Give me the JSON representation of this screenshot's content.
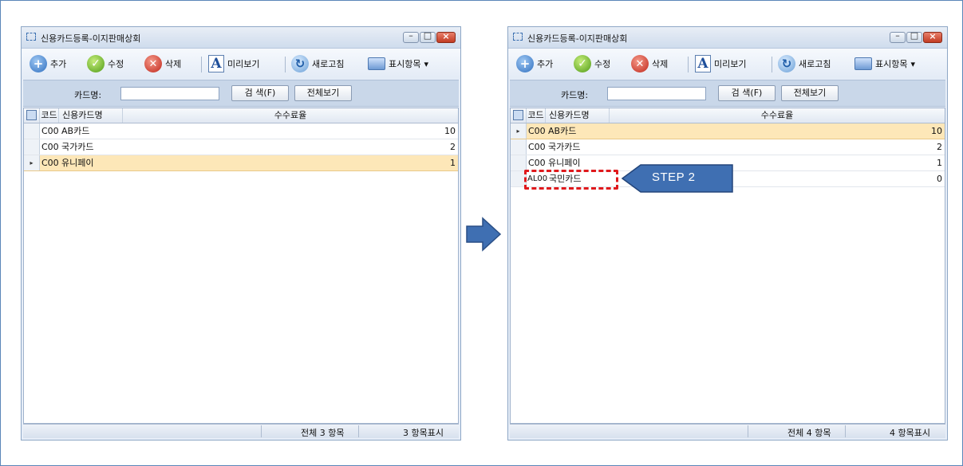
{
  "windows": [
    {
      "id": "left",
      "title": "신용카드등록-이지판매상회",
      "toolbar": {
        "add": "추가",
        "edit": "수정",
        "delete": "삭제",
        "preview": "미리보기",
        "refresh": "새로고침",
        "columns": "표시항목",
        "preview_glyph": "A",
        "dropdown_glyph": "▾"
      },
      "search": {
        "label": "카드명:",
        "value": "",
        "search_button": "검 색(F)",
        "viewall_button": "전체보기"
      },
      "grid": {
        "headers": {
          "code": "코드",
          "name": "신용카드명",
          "rate": "수수료율"
        },
        "rows": [
          {
            "code": "C001",
            "name": "AB카드",
            "rate": "10",
            "selected": false
          },
          {
            "code": "C002",
            "name": "국가카드",
            "rate": "2",
            "selected": false
          },
          {
            "code": "C003",
            "name": "유니페이",
            "rate": "1",
            "selected": true
          }
        ]
      },
      "status": {
        "total": "전체 3 항목",
        "shown": "3 항목표시"
      }
    },
    {
      "id": "right",
      "title": "신용카드등록-이지판매상회",
      "toolbar": {
        "add": "추가",
        "edit": "수정",
        "delete": "삭제",
        "preview": "미리보기",
        "refresh": "새로고침",
        "columns": "표시항목",
        "preview_glyph": "A",
        "dropdown_glyph": "▾"
      },
      "search": {
        "label": "카드명:",
        "value": "",
        "search_button": "검 색(F)",
        "viewall_button": "전체보기"
      },
      "grid": {
        "headers": {
          "code": "코드",
          "name": "신용카드명",
          "rate": "수수료율"
        },
        "rows": [
          {
            "code": "C001",
            "name": "AB카드",
            "rate": "10",
            "selected": true
          },
          {
            "code": "C002",
            "name": "국가카드",
            "rate": "2",
            "selected": false
          },
          {
            "code": "C003",
            "name": "유니페이",
            "rate": "1",
            "selected": false
          },
          {
            "code": "AL002",
            "name": "국민카드",
            "rate": "0",
            "selected": false
          }
        ]
      },
      "status": {
        "total": "전체 4 항목",
        "shown": "4 항목표시"
      }
    }
  ],
  "annotation": {
    "step_label": "STEP 2",
    "highlight_color": "#e0191c",
    "arrow_color": "#3f6fb2"
  },
  "row_marker": "▸"
}
